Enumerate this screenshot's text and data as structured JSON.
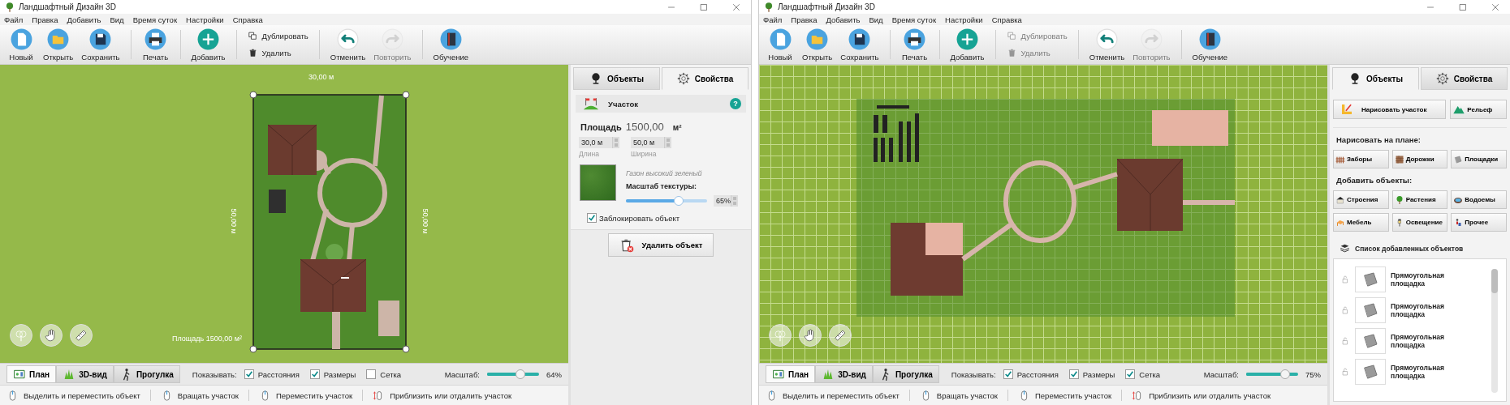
{
  "windows": [
    {
      "title": "Ландшафтный Дизайн 3D",
      "menu": [
        "Файл",
        "Правка",
        "Добавить",
        "Вид",
        "Время суток",
        "Настройки",
        "Справка"
      ],
      "toolbar": [
        {
          "kind": "big",
          "items": [
            {
              "label": "Новый",
              "disabled": false
            },
            {
              "label": "Открыть",
              "disabled": false
            },
            {
              "label": "Сохранить",
              "disabled": false
            }
          ]
        },
        {
          "kind": "big",
          "items": [
            {
              "label": "Печать",
              "disabled": false
            }
          ]
        },
        {
          "kind": "big",
          "items": [
            {
              "label": "Добавить",
              "disabled": false
            }
          ]
        },
        {
          "kind": "small",
          "items": [
            {
              "label": "Дублировать",
              "disabled": false
            },
            {
              "label": "Удалить",
              "disabled": false
            }
          ]
        },
        {
          "kind": "big",
          "items": [
            {
              "label": "Отменить",
              "disabled": false
            },
            {
              "label": "Повторить",
              "disabled": true
            }
          ]
        },
        {
          "kind": "big",
          "items": [
            {
              "label": "Обучение",
              "disabled": false
            }
          ]
        }
      ],
      "canvas": {
        "kind": "closeup",
        "dimensions": {
          "top": "30,00 м",
          "left": "50,00 м",
          "right": "50,00 м",
          "area": "Площадь 1500,00 м²"
        }
      },
      "view_tabs": [
        {
          "label": "План",
          "selected": true
        },
        {
          "label": "3D-вид",
          "selected": false
        },
        {
          "label": "Прогулка",
          "selected": false
        }
      ],
      "show_label": "Показывать:",
      "show_options": [
        {
          "label": "Расстояния",
          "checked": true
        },
        {
          "label": "Размеры",
          "checked": true
        },
        {
          "label": "Сетка",
          "checked": false
        }
      ],
      "zoom": {
        "label": "Масштаб:",
        "level": 0.64,
        "reading": "64%"
      },
      "hints": [
        "Выделить и переместить объект",
        "Вращать участок",
        "Переместить участок",
        "Приблизить или отдалить участок"
      ],
      "panel": {
        "kind": "properties",
        "tabs": [
          {
            "label": "Объекты",
            "selected": false
          },
          {
            "label": "Свойства",
            "selected": true
          }
        ],
        "header": "Участок",
        "help": "?",
        "area_label": "Площадь",
        "area_value": "1500,00",
        "area_unit": "м²",
        "fields": [
          {
            "value": "30,0 м",
            "caption": "Длина"
          },
          {
            "value": "50,0 м",
            "caption": "Ширина"
          }
        ],
        "texture_name": "Газон высокий зеленый",
        "texture_scale": {
          "label": "Масштаб текстуры:",
          "level": 0.65,
          "reading": "65%"
        },
        "lock": {
          "label": "Заблокировать объект",
          "checked": true
        },
        "delete_button": "Удалить объект"
      }
    },
    {
      "title": "Ландшафтный Дизайн 3D",
      "menu": [
        "Файл",
        "Правка",
        "Добавить",
        "Вид",
        "Время суток",
        "Настройки",
        "Справка"
      ],
      "toolbar": [
        {
          "kind": "big",
          "items": [
            {
              "label": "Новый",
              "disabled": false
            },
            {
              "label": "Открыть",
              "disabled": false
            },
            {
              "label": "Сохранить",
              "disabled": false
            }
          ]
        },
        {
          "kind": "big",
          "items": [
            {
              "label": "Печать",
              "disabled": false
            }
          ]
        },
        {
          "kind": "big",
          "items": [
            {
              "label": "Добавить",
              "disabled": false
            }
          ]
        },
        {
          "kind": "small",
          "items": [
            {
              "label": "Дублировать",
              "disabled": true
            },
            {
              "label": "Удалить",
              "disabled": true
            }
          ]
        },
        {
          "kind": "big",
          "items": [
            {
              "label": "Отменить",
              "disabled": false
            },
            {
              "label": "Повторить",
              "disabled": true
            }
          ]
        },
        {
          "kind": "big",
          "items": [
            {
              "label": "Обучение",
              "disabled": false
            }
          ]
        }
      ],
      "canvas": {
        "kind": "overview"
      },
      "view_tabs": [
        {
          "label": "План",
          "selected": true
        },
        {
          "label": "3D-вид",
          "selected": false
        },
        {
          "label": "Прогулка",
          "selected": false
        }
      ],
      "show_label": "Показывать:",
      "show_options": [
        {
          "label": "Расстояния",
          "checked": true
        },
        {
          "label": "Размеры",
          "checked": true
        },
        {
          "label": "Сетка",
          "checked": true
        }
      ],
      "zoom": {
        "label": "Масштаб:",
        "level": 0.75,
        "reading": "75%"
      },
      "hints": [
        "Выделить и переместить объект",
        "Вращать участок",
        "Переместить участок",
        "Приблизить или отдалить участок"
      ],
      "panel": {
        "kind": "objects",
        "tabs": [
          {
            "label": "Объекты",
            "selected": true
          },
          {
            "label": "Свойства",
            "selected": false
          }
        ],
        "primary_buttons": [
          "Нарисовать участок",
          "Рельеф"
        ],
        "sections": [
          {
            "heading": "Нарисовать на плане:",
            "buttons": [
              "Заборы",
              "Дорожки",
              "Площадки"
            ]
          },
          {
            "heading": "Добавить объекты:",
            "buttons": [
              "Строения",
              "Растения",
              "Водоемы",
              "Мебель",
              "Освещение",
              "Прочее"
            ]
          }
        ],
        "list_title": "Список добавленных объектов",
        "list_items": [
          "Прямоугольная площадка",
          "Прямоугольная площадка",
          "Прямоугольная площадка",
          "Прямоугольная площадка"
        ]
      }
    }
  ]
}
